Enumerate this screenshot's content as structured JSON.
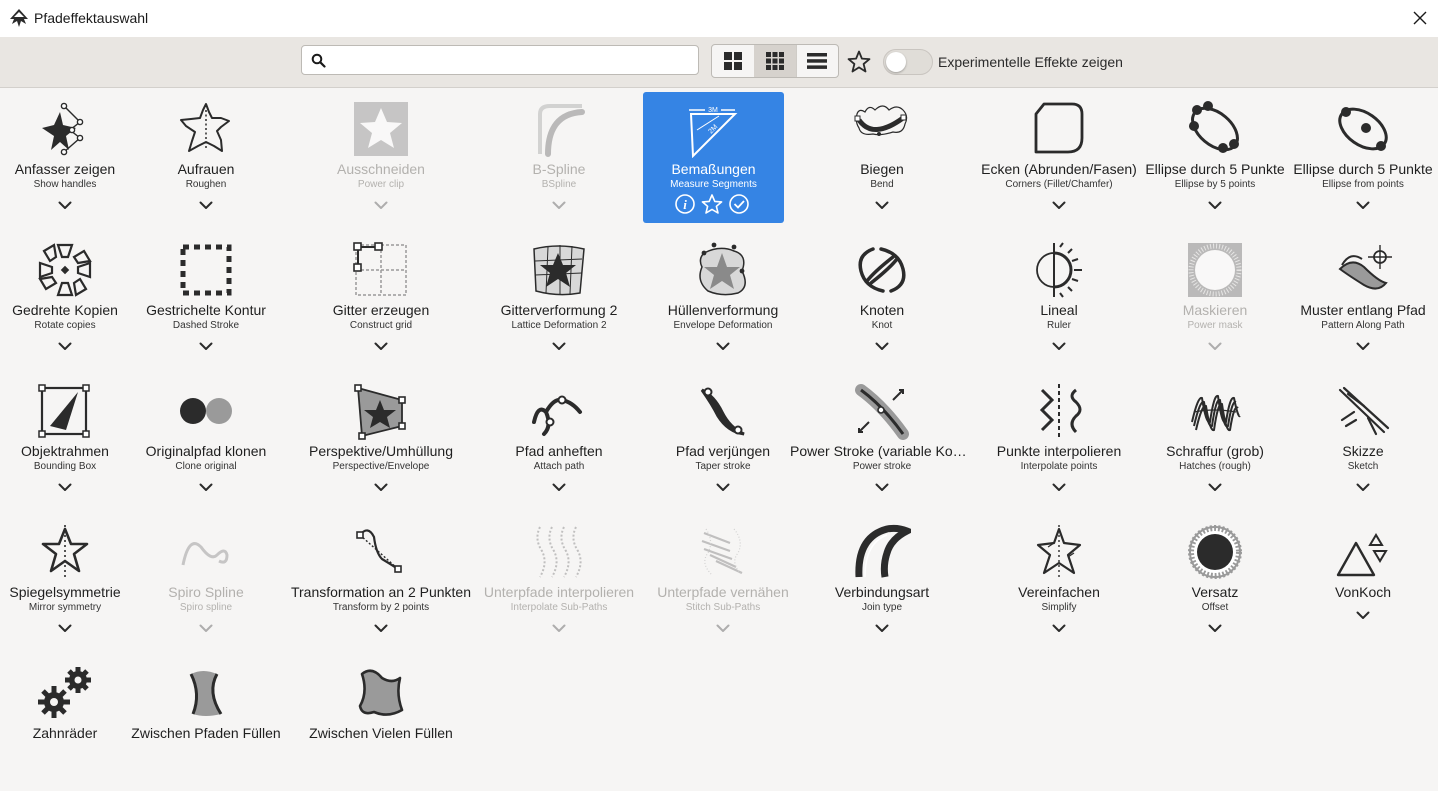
{
  "window": {
    "title": "Pfadeffektauswahl"
  },
  "toolbar": {
    "search_placeholder": "",
    "search_value": "",
    "experimental_label": "Experimentelle Effekte zeigen",
    "experimental_enabled": false,
    "active_view": "grid-medium"
  },
  "effects": [
    {
      "label": "Anfasser zeigen",
      "sub": "Show handles"
    },
    {
      "label": "Aufrauen",
      "sub": "Roughen"
    },
    {
      "label": "Ausschneiden",
      "sub": "Power clip"
    },
    {
      "label": "B-Spline",
      "sub": "BSpline"
    },
    {
      "label": "Bemaßungen",
      "sub": "Measure Segments"
    },
    {
      "label": "Biegen",
      "sub": "Bend"
    },
    {
      "label": "Ecken (Abrunden/Fasen)",
      "sub": "Corners (Fillet/Chamfer)"
    },
    {
      "label": "Ellipse durch 5 Punkte",
      "sub": "Ellipse by 5 points"
    },
    {
      "label": "Ellipse durch 5 Punkte",
      "sub": "Ellipse from points"
    },
    {
      "label": "Gedrehte Kopien",
      "sub": "Rotate copies"
    },
    {
      "label": "Gestrichelte Kontur",
      "sub": "Dashed Stroke"
    },
    {
      "label": "Gitter erzeugen",
      "sub": "Construct grid"
    },
    {
      "label": "Gitterverformung 2",
      "sub": "Lattice Deformation 2"
    },
    {
      "label": "Hüllenverformung",
      "sub": "Envelope Deformation"
    },
    {
      "label": "Knoten",
      "sub": "Knot"
    },
    {
      "label": "Lineal",
      "sub": "Ruler"
    },
    {
      "label": "Maskieren",
      "sub": "Power mask"
    },
    {
      "label": "Muster entlang Pfad",
      "sub": "Pattern Along Path"
    },
    {
      "label": "Objektrahmen",
      "sub": "Bounding Box"
    },
    {
      "label": "Originalpfad klonen",
      "sub": "Clone original"
    },
    {
      "label": "Perspektive/Umhüllung",
      "sub": "Perspective/Envelope"
    },
    {
      "label": "Pfad anheften",
      "sub": "Attach path"
    },
    {
      "label": "Pfad verjüngen",
      "sub": "Taper stroke"
    },
    {
      "label": "Power Stroke (variable Kont…",
      "sub": "Power stroke"
    },
    {
      "label": "Punkte interpolieren",
      "sub": "Interpolate points"
    },
    {
      "label": "Schraffur (grob)",
      "sub": "Hatches (rough)"
    },
    {
      "label": "Skizze",
      "sub": "Sketch"
    },
    {
      "label": "Spiegelsymmetrie",
      "sub": "Mirror symmetry"
    },
    {
      "label": "Spiro Spline",
      "sub": "Spiro spline"
    },
    {
      "label": "Transformation an 2 Punkten",
      "sub": "Transform by 2 points"
    },
    {
      "label": "Unterpfade interpolieren",
      "sub": "Interpolate Sub-Paths"
    },
    {
      "label": "Unterpfade vernähen",
      "sub": "Stitch Sub-Paths"
    },
    {
      "label": "Verbindungsart",
      "sub": "Join type"
    },
    {
      "label": "Vereinfachen",
      "sub": "Simplify"
    },
    {
      "label": "Versatz",
      "sub": "Offset"
    },
    {
      "label": "VonKoch",
      "sub": ""
    },
    {
      "label": "Zahnräder",
      "sub": ""
    },
    {
      "label": "Zwischen Pfaden Füllen",
      "sub": ""
    },
    {
      "label": "Zwischen Vielen Füllen",
      "sub": ""
    }
  ],
  "effect_meta": [
    {
      "icon": "show-handles-icon"
    },
    {
      "icon": "roughen-icon"
    },
    {
      "icon": "power-clip-icon",
      "disabled": true
    },
    {
      "icon": "bspline-icon",
      "disabled": true
    },
    {
      "icon": "measure-segments-icon",
      "selected": true
    },
    {
      "icon": "bend-icon"
    },
    {
      "icon": "corners-icon"
    },
    {
      "icon": "ellipse-5-points-icon"
    },
    {
      "icon": "ellipse-from-points-icon"
    },
    {
      "icon": "rotate-copies-icon"
    },
    {
      "icon": "dashed-stroke-icon"
    },
    {
      "icon": "construct-grid-icon"
    },
    {
      "icon": "lattice-deformation-icon"
    },
    {
      "icon": "envelope-deformation-icon"
    },
    {
      "icon": "knot-icon"
    },
    {
      "icon": "ruler-icon"
    },
    {
      "icon": "power-mask-icon",
      "disabled": true
    },
    {
      "icon": "pattern-along-path-icon"
    },
    {
      "icon": "bounding-box-icon"
    },
    {
      "icon": "clone-original-icon"
    },
    {
      "icon": "perspective-envelope-icon"
    },
    {
      "icon": "attach-path-icon"
    },
    {
      "icon": "taper-stroke-icon"
    },
    {
      "icon": "power-stroke-icon"
    },
    {
      "icon": "interpolate-points-icon"
    },
    {
      "icon": "hatches-icon"
    },
    {
      "icon": "sketch-icon"
    },
    {
      "icon": "mirror-symmetry-icon"
    },
    {
      "icon": "spiro-spline-icon",
      "disabled": true
    },
    {
      "icon": "transform-2-points-icon"
    },
    {
      "icon": "interpolate-subpaths-icon",
      "disabled": true
    },
    {
      "icon": "stitch-subpaths-icon",
      "disabled": true
    },
    {
      "icon": "join-type-icon"
    },
    {
      "icon": "simplify-icon"
    },
    {
      "icon": "offset-icon"
    },
    {
      "icon": "vonkoch-icon"
    },
    {
      "icon": "gears-icon"
    },
    {
      "icon": "fill-between-paths-icon"
    },
    {
      "icon": "fill-between-many-icon"
    }
  ],
  "selected_effect": {
    "actions": [
      "info-icon",
      "favorite-star-icon",
      "apply-check-icon"
    ]
  },
  "colors": {
    "accent": "#3584e4",
    "icon": "#2b2b2b"
  }
}
